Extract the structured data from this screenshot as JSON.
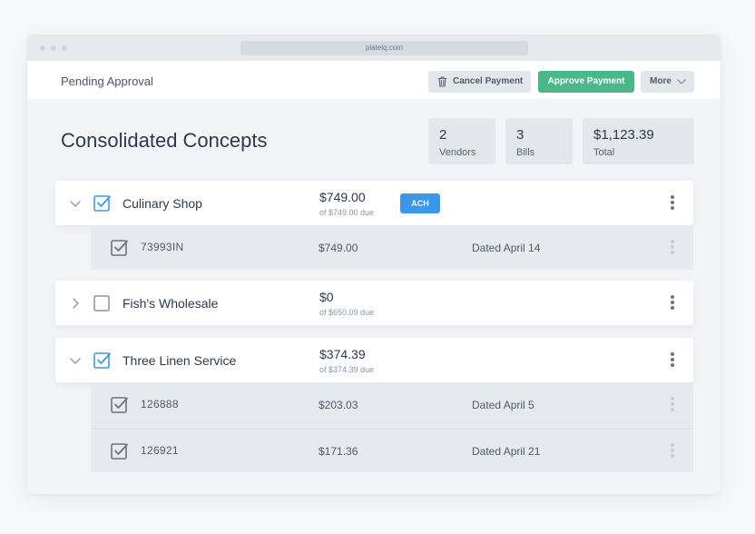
{
  "browser": {
    "url": "plateiq.com"
  },
  "header": {
    "title": "Pending Approval",
    "cancel_label": "Cancel Payment",
    "approve_label": "Approve Payment",
    "more_label": "More"
  },
  "page": {
    "title": "Consolidated Concepts"
  },
  "stats": [
    {
      "value": "2",
      "label": "Vendors"
    },
    {
      "value": "3",
      "label": "Bills"
    },
    {
      "value": "$1,123.39",
      "label": "Total"
    }
  ],
  "vendors": [
    {
      "name": "Culinary Shop",
      "amount": "$749.00",
      "due": "of $749.00 due",
      "badge": "ACH",
      "checked": true,
      "expanded": true,
      "bills": [
        {
          "number": "73993IN",
          "amount": "$749.00",
          "date": "Dated April 14",
          "checked": true
        }
      ]
    },
    {
      "name": "Fish's Wholesale",
      "amount": "$0",
      "due": "of $650.09 due",
      "checked": false,
      "expanded": false,
      "bills": []
    },
    {
      "name": "Three Linen Service",
      "amount": "$374.39",
      "due": "of $374.39 due",
      "checked": true,
      "expanded": true,
      "bills": [
        {
          "number": "126888",
          "amount": "$203.03",
          "date": "Dated April 5",
          "checked": true
        },
        {
          "number": "126921",
          "amount": "$171.36",
          "date": "Dated April 21",
          "checked": true
        }
      ]
    }
  ],
  "colors": {
    "approve": "#4cb88a",
    "ach_badge": "#3d97e6",
    "checkbox_checked": "#3d97e6",
    "checkbox_bill": "#6b7482"
  },
  "icons": {
    "trash": "trash-icon",
    "chevron_down": "chevron-down-icon",
    "chevron_right": "chevron-right-icon",
    "kebab": "kebab-menu-icon"
  }
}
